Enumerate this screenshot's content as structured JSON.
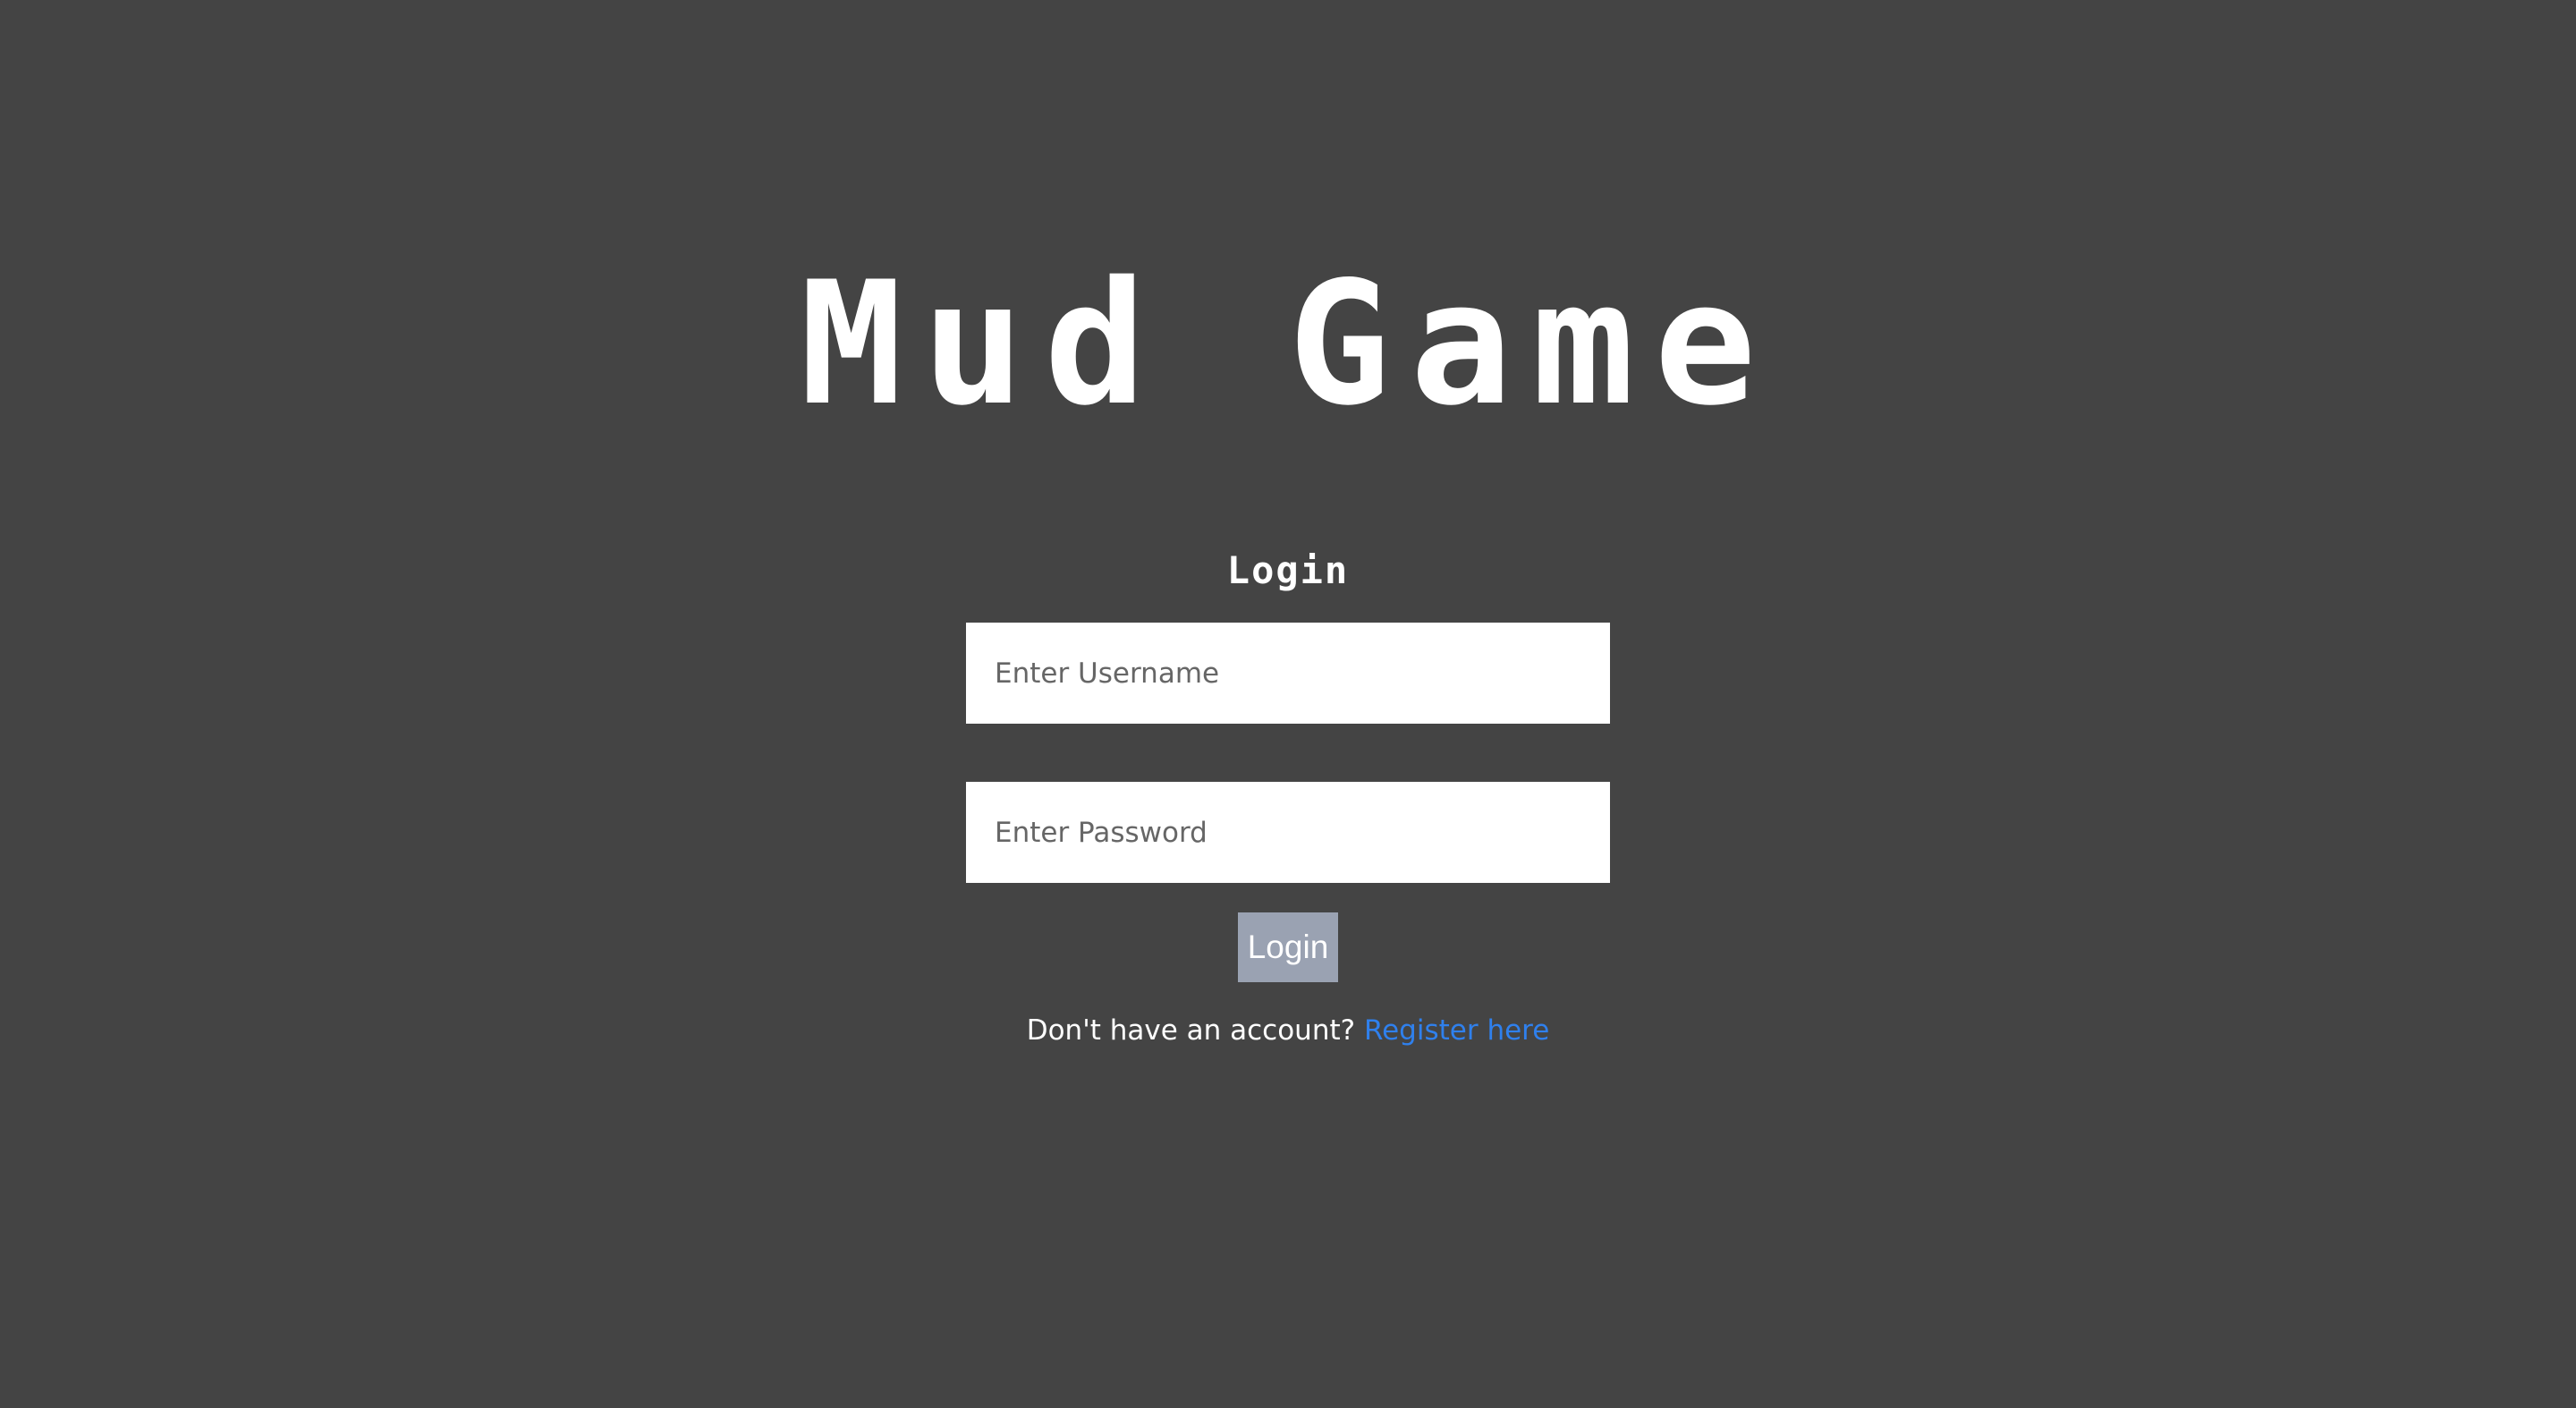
{
  "page": {
    "title": "Mud Game",
    "background_color": "#444444"
  },
  "login_form": {
    "heading": "Login",
    "username_placeholder": "Enter Username",
    "username_value": "",
    "password_placeholder": "Enter Password",
    "password_value": "",
    "submit_label": "Login",
    "submit_color": "#9aa2b2"
  },
  "register": {
    "prompt": "Don't have an account?",
    "link_label": "Register here",
    "link_color": "#2f80ed"
  }
}
